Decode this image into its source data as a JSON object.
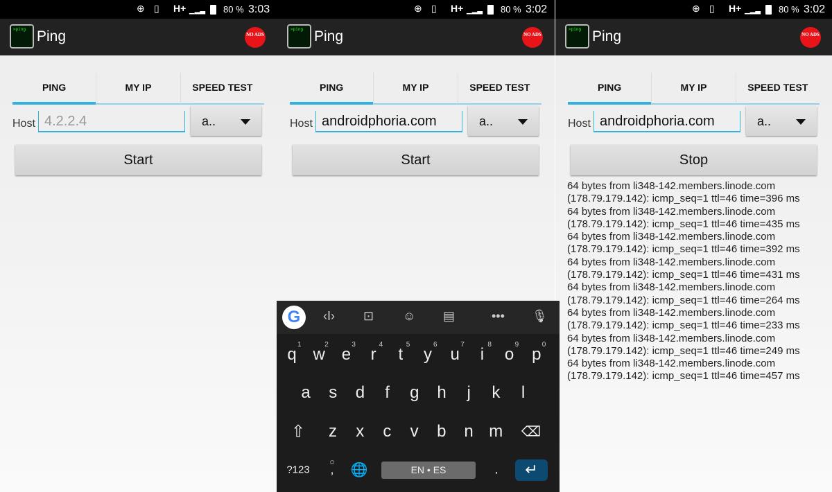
{
  "status_bars": [
    {
      "battery": "80 %",
      "time": "3:03"
    },
    {
      "battery": "80 %",
      "time": "3:02"
    },
    {
      "battery": "80 %",
      "time": "3:02"
    }
  ],
  "app": {
    "title": "Ping",
    "icon_text": ">ping",
    "no_ads": "NO ADS"
  },
  "tabs": [
    "PING",
    "MY IP",
    "SPEED TEST"
  ],
  "host_label": "Host",
  "dropdown_value": "a..",
  "screens": [
    {
      "host_value": "",
      "host_placeholder": "4.2.2.4",
      "button": "Start"
    },
    {
      "host_value": "androidphoria.com",
      "host_placeholder": "",
      "button": "Start"
    },
    {
      "host_value": "androidphoria.com",
      "host_placeholder": "",
      "button": "Stop"
    }
  ],
  "ping_output": [
    "64 bytes from li348-142.members.linode.com",
    "(178.79.179.142): icmp_seq=1 ttl=46 time=396 ms",
    "64 bytes from li348-142.members.linode.com",
    "(178.79.179.142): icmp_seq=1 ttl=46 time=435 ms",
    "64 bytes from li348-142.members.linode.com",
    "(178.79.179.142): icmp_seq=1 ttl=46 time=392 ms",
    "64 bytes from li348-142.members.linode.com",
    "(178.79.179.142): icmp_seq=1 ttl=46 time=431 ms",
    "64 bytes from li348-142.members.linode.com",
    "(178.79.179.142): icmp_seq=1 ttl=46 time=264 ms",
    "64 bytes from li348-142.members.linode.com",
    "(178.79.179.142): icmp_seq=1 ttl=46 time=233 ms",
    "64 bytes from li348-142.members.linode.com",
    "(178.79.179.142): icmp_seq=1 ttl=46 time=249 ms",
    "64 bytes from li348-142.members.linode.com",
    "(178.79.179.142): icmp_seq=1 ttl=46 time=457 ms"
  ],
  "keyboard": {
    "rows": [
      [
        "q",
        "w",
        "e",
        "r",
        "t",
        "y",
        "u",
        "i",
        "o",
        "p"
      ],
      [
        "a",
        "s",
        "d",
        "f",
        "g",
        "h",
        "j",
        "k",
        "l"
      ],
      [
        "z",
        "x",
        "c",
        "v",
        "b",
        "n",
        "m"
      ]
    ],
    "numbers": [
      "1",
      "2",
      "3",
      "4",
      "5",
      "6",
      "7",
      "8",
      "9",
      "0"
    ],
    "symbols_key": "?123",
    "comma": ",",
    "period": ".",
    "space_label": "EN • ES",
    "toolbar_icons": [
      "google-icon",
      "text-cursor-icon",
      "translate-icon",
      "sticker-icon",
      "clipboard-icon",
      "more-icon",
      "microphone-icon"
    ],
    "enter_color": "#0d4a72"
  },
  "colors": {
    "accent": "#33b0de",
    "appbar": "#222222",
    "no_ads": "#e8141a"
  }
}
